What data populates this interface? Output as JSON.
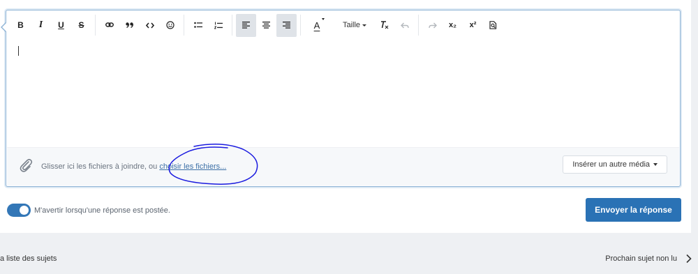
{
  "toolbar": {
    "buttons": [
      {
        "name": "bold-button",
        "label": "B"
      },
      {
        "name": "italic-button",
        "label": "I"
      },
      {
        "name": "underline-button",
        "label": "U"
      },
      {
        "name": "strikethrough-button",
        "label": "S"
      }
    ],
    "size_label": "Taille",
    "icons": {
      "link": "link-icon",
      "quote": "quote-icon",
      "code": "code-icon",
      "emoji": "emoji-icon",
      "bullets": "bulleted-list-icon",
      "numbers": "numbered-list-icon",
      "align_left": "align-left-icon",
      "align_center": "align-center-icon",
      "align_right": "align-right-icon",
      "text_color": "text-color-icon",
      "clear_format": "clear-format-icon",
      "undo": "undo-icon",
      "redo": "redo-icon",
      "subscript": "subscript-icon",
      "superscript": "superscript-icon",
      "preview": "preview-icon"
    },
    "text_color_glyph": "A",
    "subscript_glyph": "x₂",
    "superscript_glyph": "x²"
  },
  "attachments": {
    "prefix": "Glisser ici les fichiers à joindre, ou ",
    "link": "choisir les fichiers...",
    "media_button": "Insérer un autre média",
    "annotation_color": "#1a1adf"
  },
  "notify": {
    "label": "M'avertir lorsqu'une réponse est postée.",
    "enabled": true
  },
  "submit_label": "Envoyer la réponse",
  "footer": {
    "left": "a liste des sujets",
    "right": "Prochain sujet non lu"
  },
  "colors": {
    "accent": "#2a72b5",
    "toggle": "#3377b7",
    "editor_border": "#8fb4d6"
  }
}
